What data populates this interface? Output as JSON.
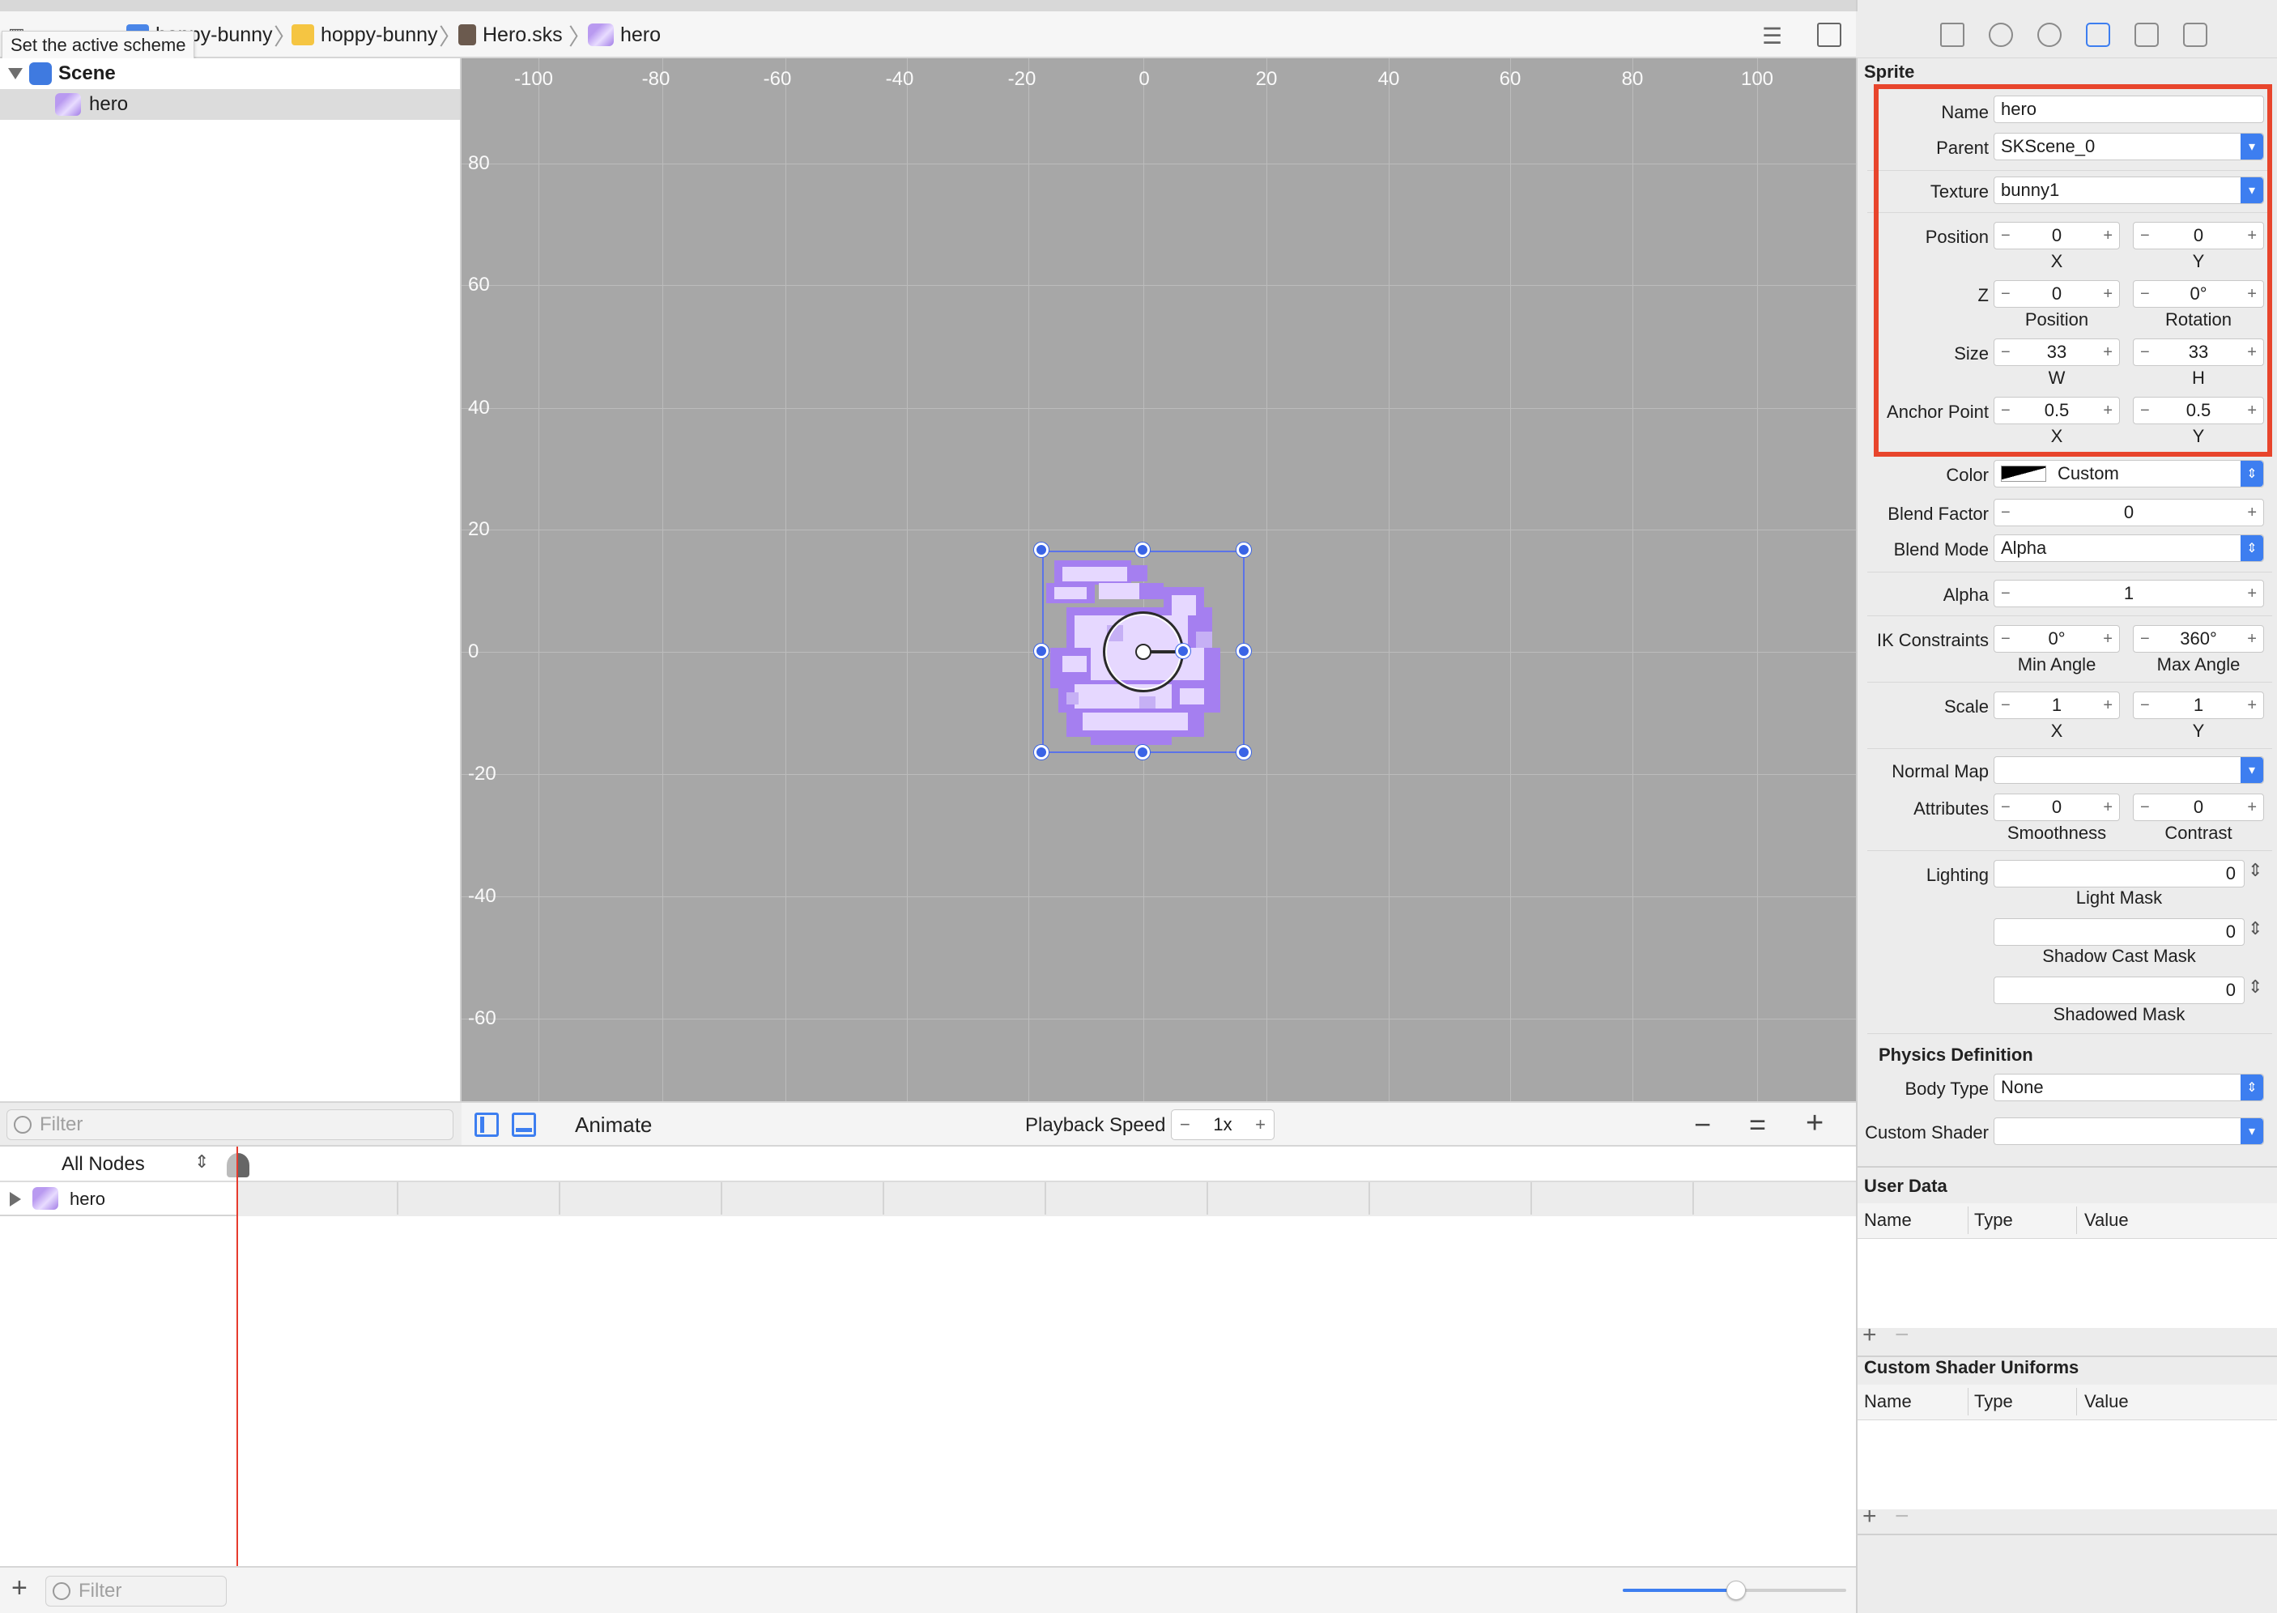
{
  "tooltip": "Set the active scheme",
  "breadcrumb": {
    "project": "hoppy-bunny",
    "folder": "hoppy-bunny",
    "file": "Hero.sks",
    "node": "hero"
  },
  "scene_tree": {
    "root": "Scene",
    "child": "hero",
    "filter_placeholder": "Filter"
  },
  "canvas": {
    "x_ticks": [
      "-100",
      "-80",
      "-60",
      "-40",
      "-20",
      "0",
      "20",
      "40",
      "60",
      "80",
      "100"
    ],
    "y_ticks": [
      "80",
      "60",
      "40",
      "20",
      "0",
      "-20",
      "-40",
      "-60"
    ]
  },
  "canvas_footer": {
    "animate_label": "Animate",
    "playback_label": "Playback Speed",
    "playback_value": "1x",
    "minus": "−",
    "equal": "=",
    "plus": "+"
  },
  "timeline": {
    "filter_select": "All Nodes",
    "row": "hero",
    "filter_placeholder": "Filter",
    "zoom_fraction": 0.5
  },
  "inspector": {
    "section": "Sprite",
    "name_label": "Name",
    "name_value": "hero",
    "parent_label": "Parent",
    "parent_value": "SKScene_0",
    "texture_label": "Texture",
    "texture_value": "bunny1",
    "position_label": "Position",
    "position_x": "0",
    "position_y": "0",
    "x_sub": "X",
    "y_sub": "Y",
    "z_label": "Z",
    "z_position": "0",
    "z_rotation": "0°",
    "position_sub": "Position",
    "rotation_sub": "Rotation",
    "size_label": "Size",
    "size_w": "33",
    "size_h": "33",
    "w_sub": "W",
    "h_sub": "H",
    "anchor_label": "Anchor Point",
    "anchor_x": "0.5",
    "anchor_y": "0.5",
    "color_label": "Color",
    "color_value": "Custom",
    "blend_factor_label": "Blend Factor",
    "blend_factor_value": "0",
    "blend_mode_label": "Blend Mode",
    "blend_mode_value": "Alpha",
    "alpha_label": "Alpha",
    "alpha_value": "1",
    "ik_label": "IK Constraints",
    "ik_min": "0°",
    "ik_max": "360°",
    "min_angle_sub": "Min Angle",
    "max_angle_sub": "Max Angle",
    "scale_label": "Scale",
    "scale_x": "1",
    "scale_y": "1",
    "normal_map_label": "Normal Map",
    "attributes_label": "Attributes",
    "smoothness": "0",
    "contrast": "0",
    "smoothness_sub": "Smoothness",
    "contrast_sub": "Contrast",
    "lighting_label": "Lighting",
    "light_mask": "0",
    "light_mask_sub": "Light Mask",
    "shadow_cast_mask": "0",
    "shadow_cast_mask_sub": "Shadow Cast Mask",
    "shadowed_mask": "0",
    "shadowed_mask_sub": "Shadowed Mask",
    "physics_title": "Physics Definition",
    "body_type_label": "Body Type",
    "body_type_value": "None",
    "custom_shader_label": "Custom Shader",
    "user_data_title": "User Data",
    "col_name": "Name",
    "col_type": "Type",
    "col_value": "Value",
    "shader_uniforms_title": "Custom Shader Uniforms"
  },
  "colors": {
    "accent": "#3d7ef0",
    "highlight_box": "#e8452c",
    "sprite_light": "#e8dcff",
    "sprite_dark": "#a57ff0"
  }
}
